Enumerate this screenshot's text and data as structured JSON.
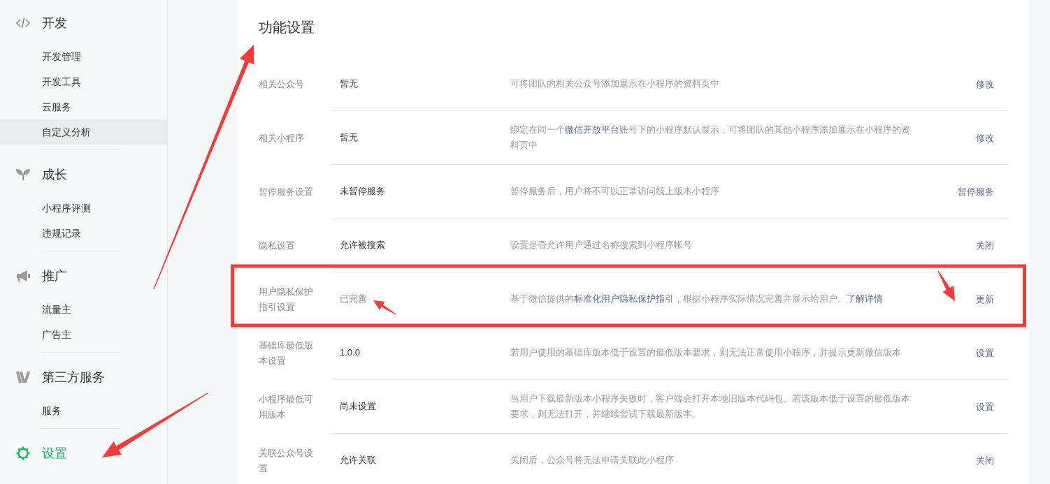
{
  "sidebar": {
    "sections": [
      {
        "title": "开发",
        "selected": false,
        "items": [
          {
            "label": "开发管理",
            "selected": false
          },
          {
            "label": "开发工具",
            "selected": false
          },
          {
            "label": "云服务",
            "selected": false
          },
          {
            "label": "自定义分析",
            "selected": true
          }
        ]
      },
      {
        "title": "成长",
        "selected": false,
        "items": [
          {
            "label": "小程序评测",
            "selected": false
          },
          {
            "label": "违规记录",
            "selected": false
          }
        ]
      },
      {
        "title": "推广",
        "selected": false,
        "items": [
          {
            "label": "流量主",
            "selected": false
          },
          {
            "label": "广告主",
            "selected": false
          }
        ]
      },
      {
        "title": "第三方服务",
        "selected": false,
        "items": [
          {
            "label": "服务",
            "selected": false
          }
        ]
      },
      {
        "title": "设置",
        "selected": true
      }
    ]
  },
  "content": {
    "title": "功能设置",
    "rows": [
      {
        "label": "相关公众号",
        "value": "暂无",
        "muted": false,
        "description": [
          {
            "text": "可将团队的相关公众号添加展示在小程序的资料页中",
            "kind": "text"
          }
        ],
        "action": "修改"
      },
      {
        "label": "相关小程序",
        "value": "暂无",
        "muted": false,
        "description": [
          {
            "text": "绑定在同一个",
            "kind": "text"
          },
          {
            "text": "微信开放平台",
            "kind": "link"
          },
          {
            "text": "账号下的小程序默认展示，可将团队的其他小程序添加展示在小程序的资料页中",
            "kind": "text"
          }
        ],
        "action": "修改"
      },
      {
        "label": "暂停服务设置",
        "value": "未暂停服务",
        "muted": false,
        "description": [
          {
            "text": "暂停服务后，用户将不可以正常访问线上版本小程序",
            "kind": "text"
          }
        ],
        "action": "暂停服务"
      },
      {
        "label": "隐私设置",
        "value": "允许被搜索",
        "muted": false,
        "description": [
          {
            "text": "设置是否允许用户通过名称搜索到小程序帐号",
            "kind": "text"
          }
        ],
        "action": "关闭"
      },
      {
        "label": "用户隐私保护指引设置",
        "value": "已完善",
        "muted": true,
        "description": [
          {
            "text": "基于微信提供的",
            "kind": "text"
          },
          {
            "text": "标准化用户隐私保护指引",
            "kind": "link"
          },
          {
            "text": "，根据小程序实际情况完善并展示给用户。",
            "kind": "text"
          },
          {
            "text": "了解详情",
            "kind": "link"
          }
        ],
        "action": "更新"
      },
      {
        "label": "基础库最低版本设置",
        "value": "1.0.0",
        "muted": false,
        "description": [
          {
            "text": "若用户使用的基础库版本低于设置的最低版本要求，则无法正常使用小程序，并提示更新微信版本",
            "kind": "text"
          }
        ],
        "action": "设置"
      },
      {
        "label": "小程序最低可用版本",
        "value": "尚未设置",
        "muted": false,
        "description": [
          {
            "text": "当用户下载最新版本小程序失败时，客户端会打开本地旧版本代码包。若该版本低于设置的最低版本要求，则无法打开，并继续尝试下载最新版本。",
            "kind": "text"
          }
        ],
        "action": "设置"
      },
      {
        "label": "关联公众号设置",
        "value": "允许关联",
        "muted": false,
        "description": [
          {
            "text": "关闭后，公众号将无法申请关联此小程序",
            "kind": "text"
          }
        ],
        "action": "关闭"
      }
    ]
  }
}
